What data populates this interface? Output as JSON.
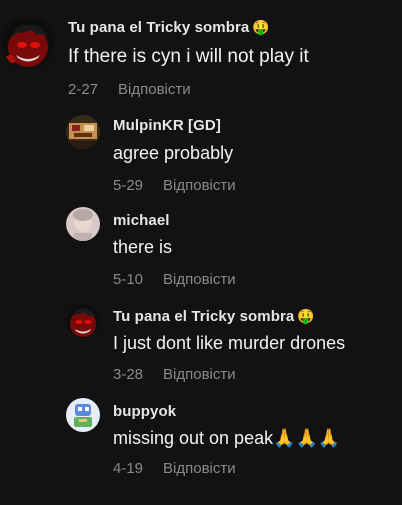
{
  "reply_label": "Відповісти",
  "comments": [
    {
      "author": "Tu pana el Tricky sombra",
      "author_emoji": "🤑",
      "text": "If there is cyn i will not play it",
      "date": "2-27",
      "avatar_icon": "tricky-avatar-icon"
    },
    {
      "author": "MulpinKR [GD]",
      "author_emoji": "",
      "text": "agree probably",
      "date": "5-29",
      "avatar_icon": "mulpin-avatar-icon"
    },
    {
      "author": "michael",
      "author_emoji": "",
      "text": "there is",
      "date": "5-10",
      "avatar_icon": "michael-avatar-icon"
    },
    {
      "author": "Tu pana el Tricky sombra",
      "author_emoji": "🤑",
      "text": "I just dont like murder drones",
      "date": "3-28",
      "avatar_icon": "tricky-avatar-icon"
    },
    {
      "author": "buppyok",
      "author_emoji": "",
      "text": "missing out on peak🙏🙏🙏",
      "date": "4-19",
      "avatar_icon": "buppyok-avatar-icon"
    }
  ]
}
